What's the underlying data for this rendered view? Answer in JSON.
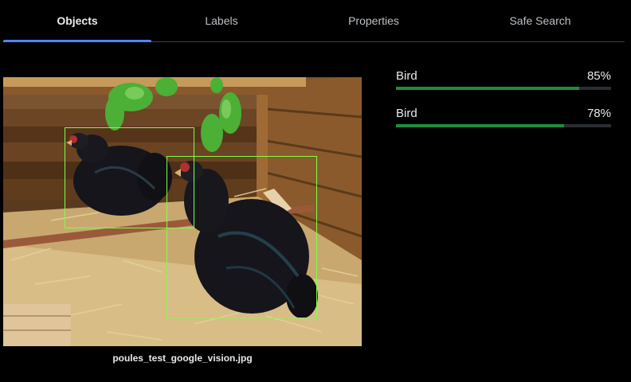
{
  "tabs": [
    {
      "label": "Objects",
      "active": true
    },
    {
      "label": "Labels",
      "active": false
    },
    {
      "label": "Properties",
      "active": false
    },
    {
      "label": "Safe Search",
      "active": false
    }
  ],
  "image": {
    "filename": "poules_test_google_vision.jpg",
    "box_color": "#7cff4a"
  },
  "results": [
    {
      "label": "Bird",
      "score": "85%",
      "fraction": 0.85
    },
    {
      "label": "Bird",
      "score": "78%",
      "fraction": 0.78
    }
  ],
  "colors": {
    "accent": "#4f86f7",
    "bar_fill": "#1e8e3e",
    "bar_track": "#2a2d31",
    "background": "#000000"
  }
}
